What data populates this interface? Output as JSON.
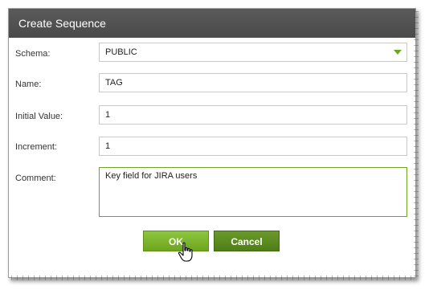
{
  "dialog": {
    "title": "Create Sequence"
  },
  "form": {
    "schema_label": "Schema:",
    "schema_value": "PUBLIC",
    "name_label": "Name:",
    "name_value": "TAG",
    "initial_value_label": "Initial Value:",
    "initial_value_value": "1",
    "increment_label": "Increment:",
    "increment_value": "1",
    "comment_label": "Comment:",
    "comment_value": "Key field for JIRA users"
  },
  "buttons": {
    "ok_label": "OK",
    "cancel_label": "Cancel"
  },
  "colors": {
    "accent": "#6fa51e",
    "titlebar": "#4f4f4f"
  },
  "icons": {
    "dropdown": "chevron-down-icon",
    "cursor": "hand-pointer-icon"
  }
}
